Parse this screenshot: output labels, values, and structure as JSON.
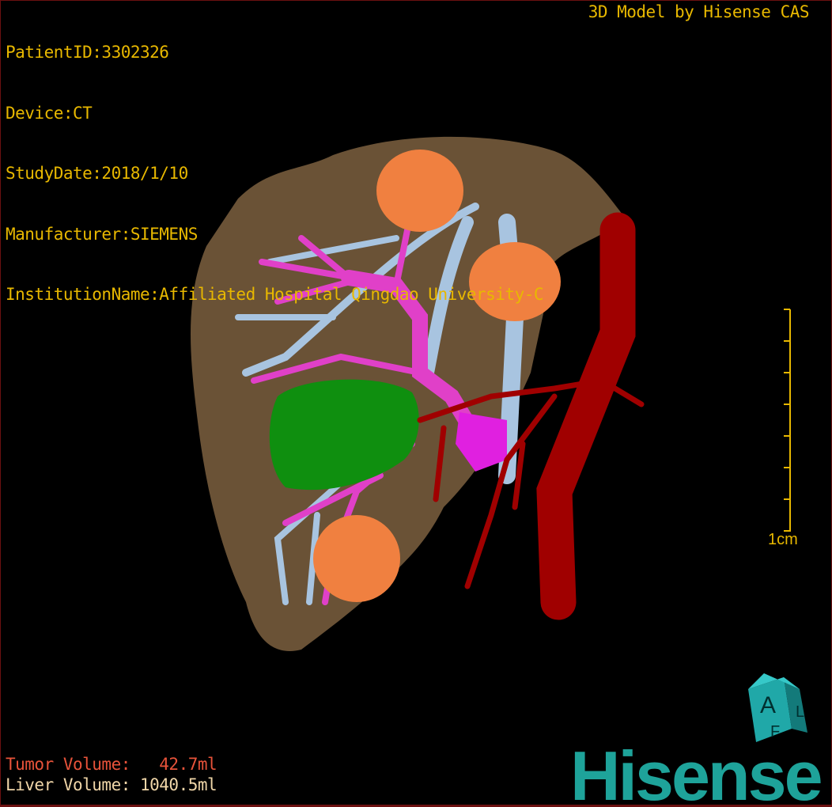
{
  "header": {
    "patient_id": "PatientID:3302326",
    "device": "Device:CT",
    "study_date": "StudyDate:2018/1/10",
    "manufacturer": "Manufacturer:SIEMENS",
    "institution": "InstitutionName:Affiliated Hospital Qingdao University-C",
    "brand_text": "3D Model by Hisense CAS"
  },
  "measurements": {
    "tumor_volume": "Tumor Volume:   42.7ml",
    "liver_volume": "Liver Volume: 1040.5ml"
  },
  "scale_bar": {
    "label": "1cm"
  },
  "orientation_cube": {
    "faces": [
      "A",
      "F",
      "L"
    ]
  },
  "logo": "Hisense",
  "colors": {
    "text": "#e8b800",
    "tumor_text": "#e8533a",
    "liver_text": "#f0d6a8",
    "liver": "#8a6a45",
    "tumor": "#0f8f0f",
    "portal_vein": "#e040c8",
    "hepatic_vein": "#a8c4e0",
    "artery": "#a00000",
    "lesions": "#f08040",
    "logo": "#1ea39a"
  }
}
